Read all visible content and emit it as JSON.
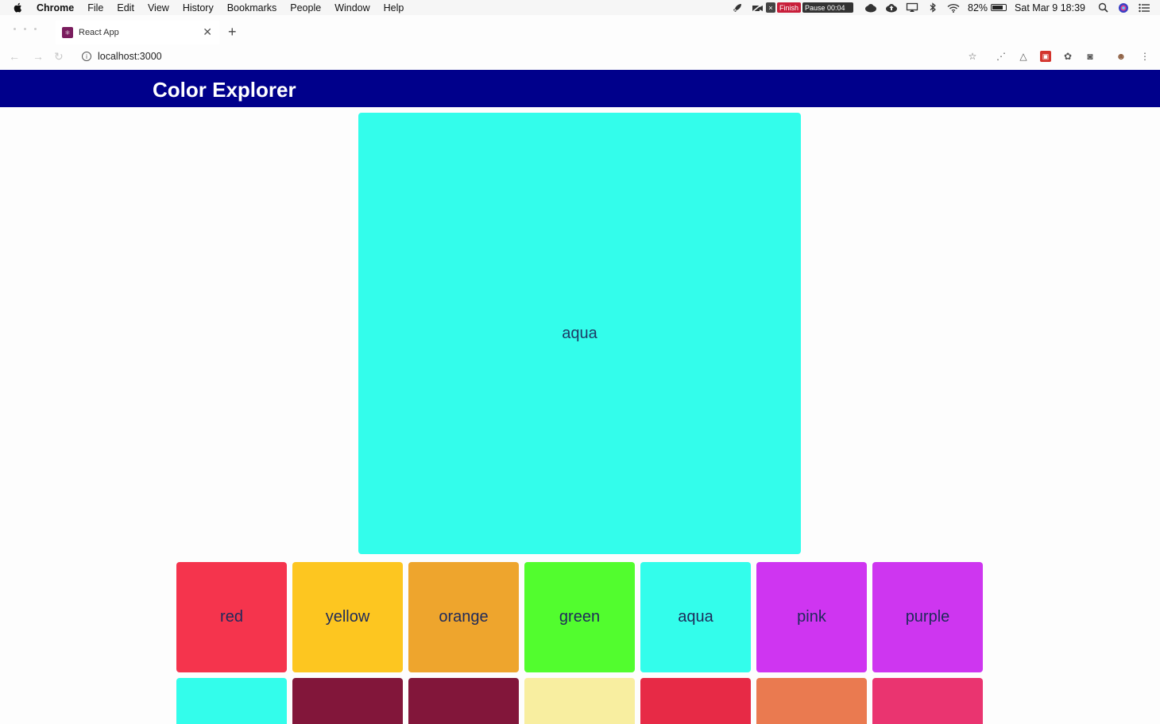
{
  "menubar": {
    "app": "Chrome",
    "items": [
      "File",
      "Edit",
      "View",
      "History",
      "Bookmarks",
      "People",
      "Window",
      "Help"
    ],
    "status": {
      "finish": "Finish",
      "pause": "Pause 00:04",
      "battery": "82%",
      "battery_level": 0.82,
      "clock": "Sat Mar 9  18:39"
    }
  },
  "browser": {
    "tab_title": "React App",
    "url": "localhost:3000"
  },
  "app": {
    "title": "Color Explorer",
    "selected": {
      "name": "aqua",
      "color": "#33fdeb"
    },
    "palette_row1": [
      {
        "name": "red",
        "color": "#f5344d"
      },
      {
        "name": "yellow",
        "color": "#fdc620"
      },
      {
        "name": "orange",
        "color": "#eea52d"
      },
      {
        "name": "green",
        "color": "#52fd2e"
      },
      {
        "name": "aqua",
        "color": "#33fdeb"
      },
      {
        "name": "pink",
        "color": "#cf35f1"
      },
      {
        "name": "purple",
        "color": "#ce36f0"
      }
    ],
    "palette_row2": [
      {
        "color": "#33fdeb"
      },
      {
        "color": "#82163a"
      },
      {
        "color": "#82163a"
      },
      {
        "color": "#f8eea0"
      },
      {
        "color": "#e72a46"
      },
      {
        "color": "#ea7a50"
      },
      {
        "color": "#ea3470"
      }
    ]
  }
}
